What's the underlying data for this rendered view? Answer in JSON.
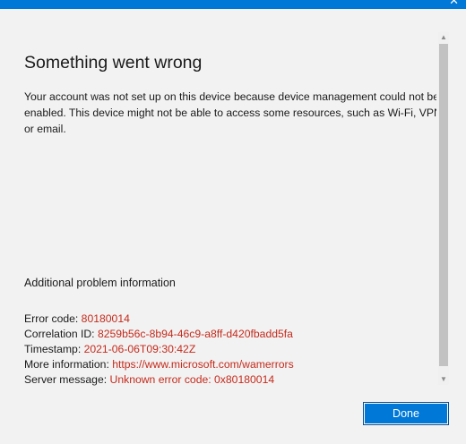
{
  "titlebar": {
    "close_glyph": "✕"
  },
  "content": {
    "heading": "Something went wrong",
    "message": "Your account was not set up on this device because device management could not be enabled. This device might not be able to access some resources, such as Wi-Fi, VPN, or email.",
    "additional_title": "Additional problem information"
  },
  "info": [
    {
      "label": "Error code: ",
      "value": "80180014"
    },
    {
      "label": "Correlation ID: ",
      "value": "8259b56c-8b94-46c9-a8ff-d420fbadd5fa"
    },
    {
      "label": "Timestamp: ",
      "value": "2021-06-06T09:30:42Z"
    },
    {
      "label": "More information: ",
      "value": "https://www.microsoft.com/wamerrors"
    },
    {
      "label": "Server message: ",
      "value": "Unknown error code: 0x80180014"
    }
  ],
  "scrollbar": {
    "up_glyph": "▲",
    "down_glyph": "▼"
  },
  "footer": {
    "done_label": "Done"
  },
  "colors": {
    "accent": "#0078d7",
    "error_value": "#c42b1c"
  }
}
